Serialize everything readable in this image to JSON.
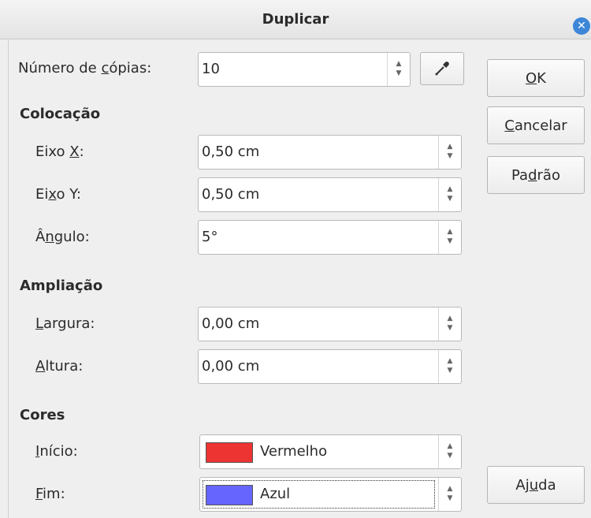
{
  "window": {
    "title": "Duplicar",
    "close_icon": "close-icon"
  },
  "copies": {
    "label_pre": "Número de ",
    "label_ul": "c",
    "label_post": "ópias:",
    "value": "10"
  },
  "placement": {
    "heading": "Colocação",
    "x_axis": {
      "label_pre": "Eixo ",
      "label_ul": "X",
      "label_post": ":",
      "value": "0,50 cm"
    },
    "y_axis": {
      "label_pre": "Ei",
      "label_ul": "x",
      "label_post": "o Y:",
      "value": "0,50 cm"
    },
    "angle": {
      "label_pre": "Â",
      "label_ul": "n",
      "label_post": "gulo:",
      "value": "5°"
    }
  },
  "enlargement": {
    "heading": "Ampliação",
    "width": {
      "label_ul": "L",
      "label_post": "argura:",
      "value": "0,00 cm"
    },
    "height": {
      "label_ul": "A",
      "label_post": "ltura:",
      "value": "0,00 cm"
    }
  },
  "colors": {
    "heading": "Cores",
    "start": {
      "label_ul": "I",
      "label_post": "nício:",
      "value": "Vermelho",
      "swatch": "#ee3333"
    },
    "end": {
      "label_ul": "F",
      "label_post": "im:",
      "value": "Azul",
      "swatch": "#6666ff"
    }
  },
  "buttons": {
    "ok": {
      "ul": "O",
      "post": "K"
    },
    "cancel": {
      "ul": "C",
      "post": "ancelar"
    },
    "default": {
      "pre": "Pa",
      "ul": "d",
      "post": "rão"
    },
    "help": {
      "pre": "Aj",
      "ul": "u",
      "post": "da"
    }
  }
}
